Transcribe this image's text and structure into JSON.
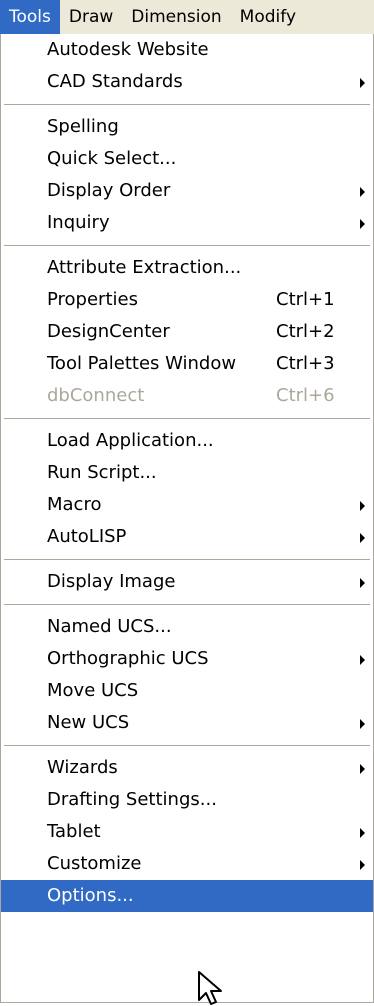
{
  "menubar": {
    "items": [
      {
        "label": "Tools",
        "active": true
      },
      {
        "label": "Draw"
      },
      {
        "label": "Dimension"
      },
      {
        "label": "Modify"
      }
    ]
  },
  "menu": {
    "groups": [
      [
        {
          "label": "Autodesk Website"
        },
        {
          "label": "CAD Standards",
          "submenu": true
        }
      ],
      [
        {
          "label": "Spelling"
        },
        {
          "label": "Quick Select..."
        },
        {
          "label": "Display Order",
          "submenu": true
        },
        {
          "label": "Inquiry",
          "submenu": true
        }
      ],
      [
        {
          "label": "Attribute Extraction..."
        },
        {
          "label": "Properties",
          "shortcut": "Ctrl+1"
        },
        {
          "label": "DesignCenter",
          "shortcut": "Ctrl+2"
        },
        {
          "label": "Tool Palettes Window",
          "shortcut": "Ctrl+3"
        },
        {
          "label": "dbConnect",
          "shortcut": "Ctrl+6",
          "disabled": true
        }
      ],
      [
        {
          "label": "Load Application..."
        },
        {
          "label": "Run Script..."
        },
        {
          "label": "Macro",
          "submenu": true
        },
        {
          "label": "AutoLISP",
          "submenu": true
        }
      ],
      [
        {
          "label": "Display Image",
          "submenu": true
        }
      ],
      [
        {
          "label": "Named UCS..."
        },
        {
          "label": "Orthographic UCS",
          "submenu": true
        },
        {
          "label": "Move UCS"
        },
        {
          "label": "New UCS",
          "submenu": true
        }
      ],
      [
        {
          "label": "Wizards",
          "submenu": true
        },
        {
          "label": "Drafting Settings..."
        },
        {
          "label": "Tablet",
          "submenu": true
        },
        {
          "label": "Customize",
          "submenu": true
        },
        {
          "label": "Options...",
          "selected": true
        }
      ]
    ]
  },
  "colors": {
    "highlight": "#316ac5",
    "menubar_bg": "#ece9d8",
    "disabled_text": "#aca899"
  }
}
